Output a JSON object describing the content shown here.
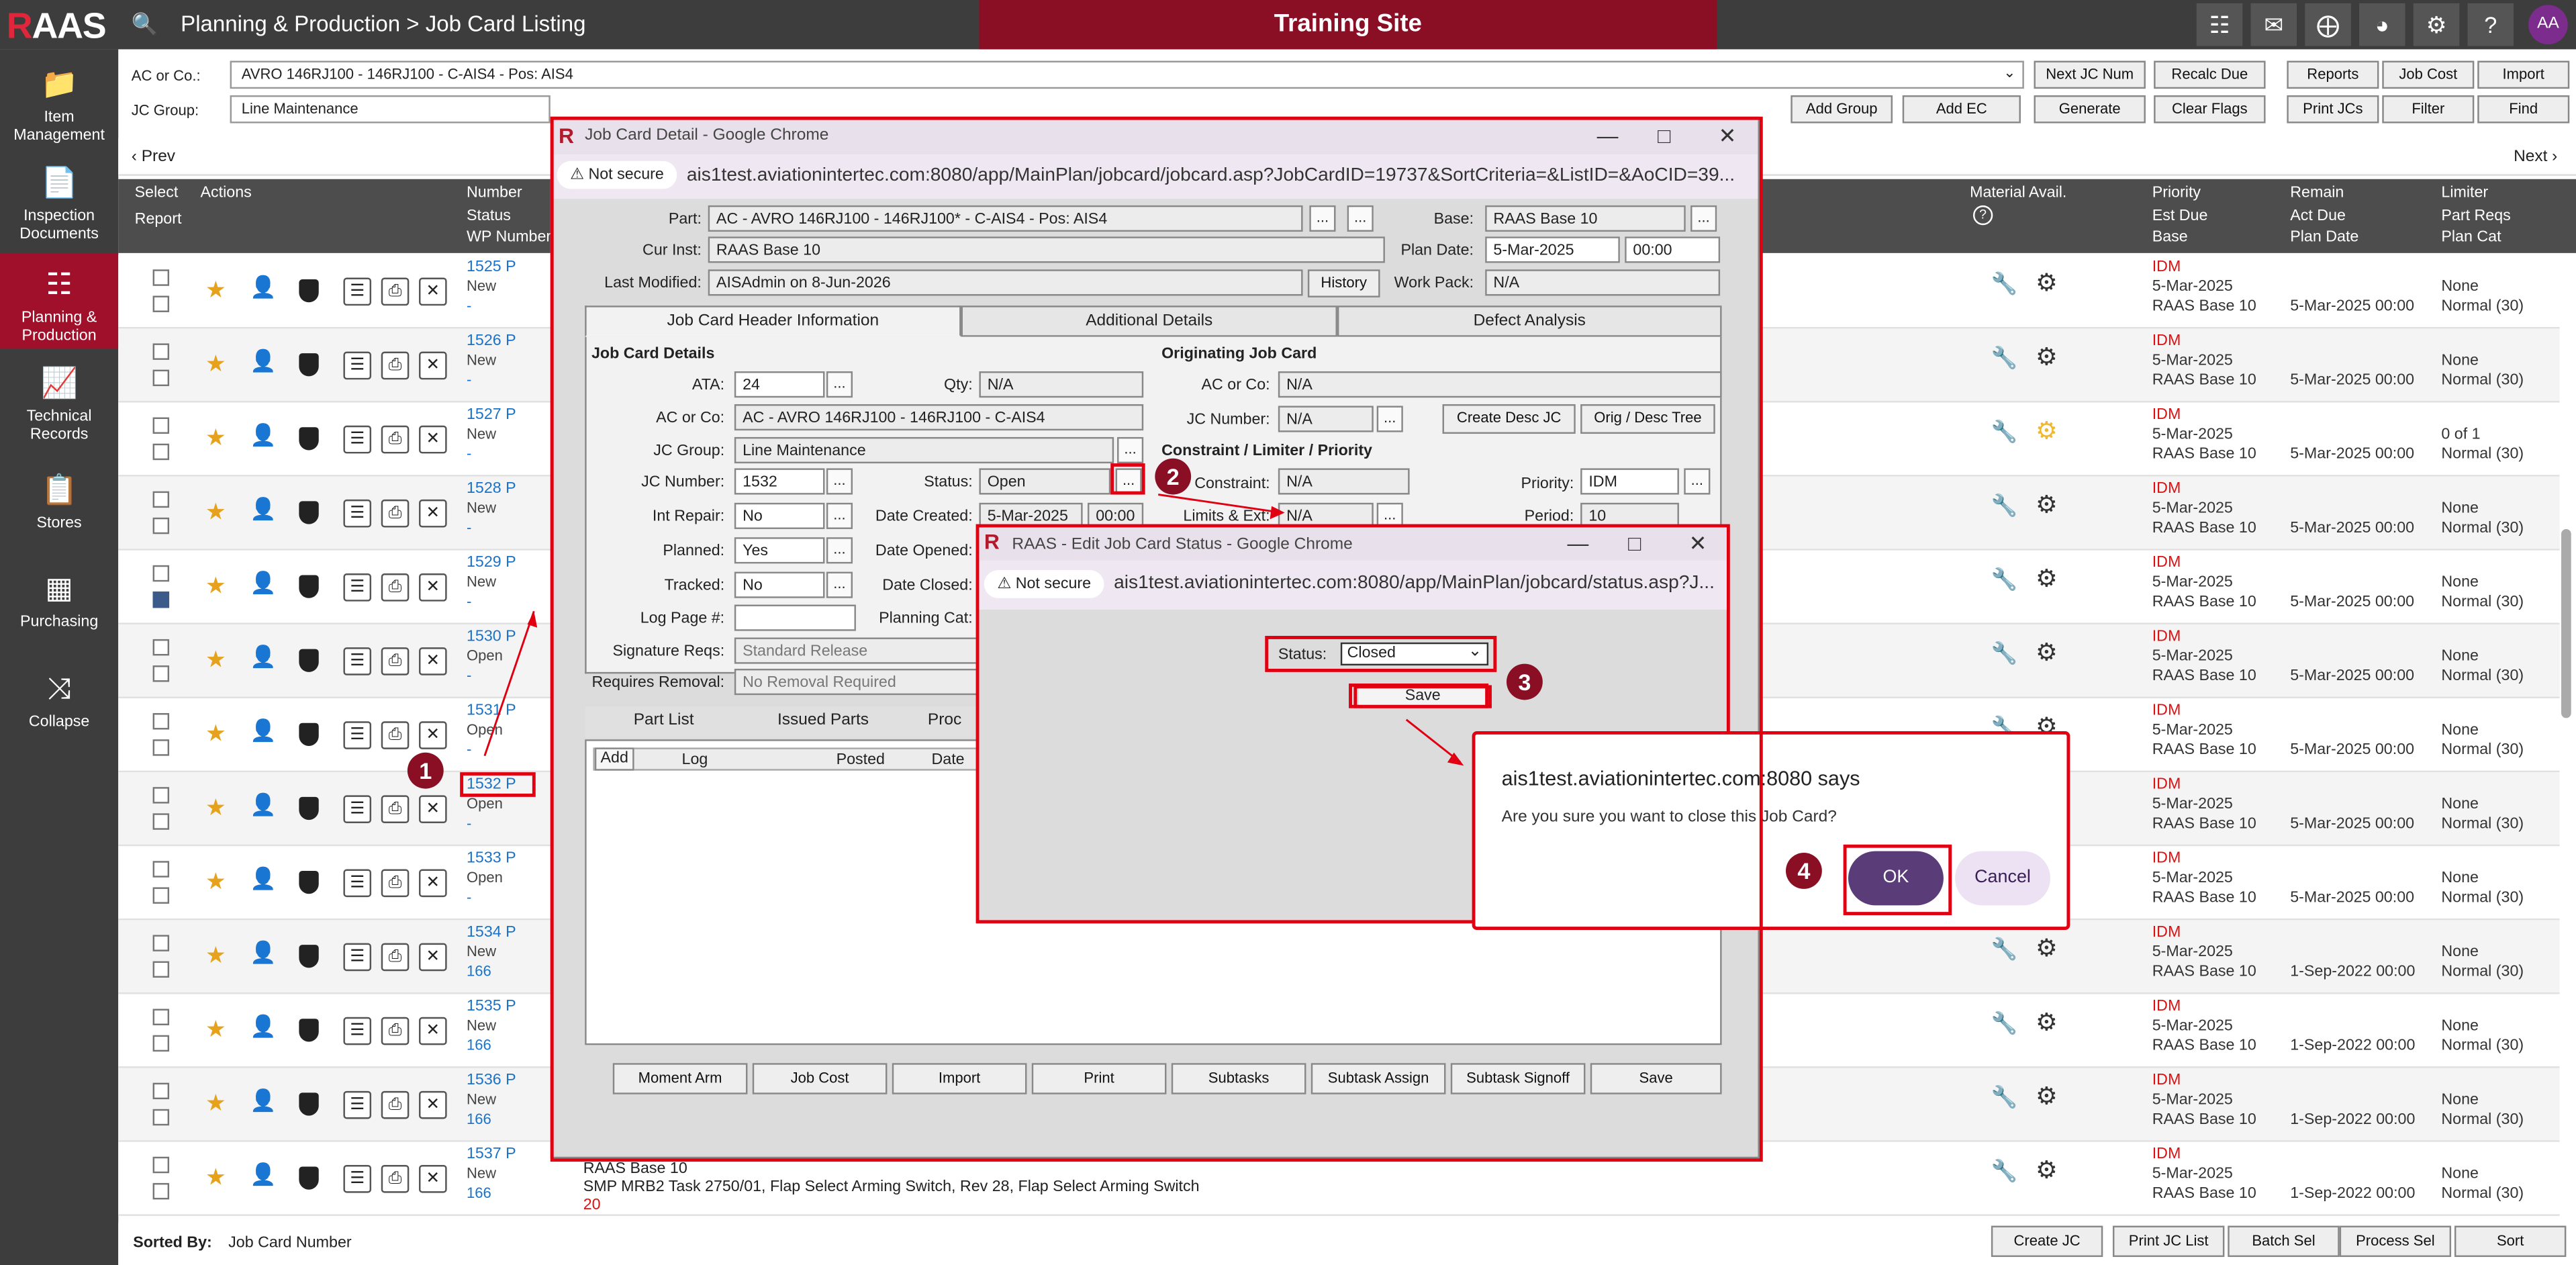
{
  "app": {
    "logo_r": "R",
    "logo_rest": "AAS",
    "breadcrumb": "Planning & Production > Job Card Listing",
    "banner": "Training Site",
    "avatar": "AA"
  },
  "sidebar": [
    {
      "label": "Item Management",
      "icon": "folder-icon"
    },
    {
      "label": "Inspection Documents",
      "icon": "document-icon"
    },
    {
      "label": "Planning & Production",
      "icon": "flow-icon"
    },
    {
      "label": "Technical Records",
      "icon": "records-icon"
    },
    {
      "label": "Stores",
      "icon": "clipboard-icon"
    },
    {
      "label": "Purchasing",
      "icon": "calculator-icon"
    },
    {
      "label": "Collapse",
      "icon": "collapse-icon"
    }
  ],
  "filters": {
    "ac_label": "AC or Co.:",
    "ac_value": "AVRO 146RJ100 - 146RJ100 - C-AIS4 - Pos: AIS4",
    "jc_label": "JC Group:",
    "jc_value": "Line Maintenance",
    "add_group": "Add Group",
    "add_ec": "Add EC"
  },
  "toolbar": {
    "next_jc": "Next JC Num",
    "recalc": "Recalc Due",
    "generate": "Generate",
    "clear_flags": "Clear Flags",
    "reports": "Reports",
    "job_cost": "Job Cost",
    "import": "Import",
    "print_jcs": "Print JCs",
    "filter": "Filter",
    "find": "Find"
  },
  "nav": {
    "prev": "Prev",
    "next": "Next"
  },
  "header": {
    "select": "Select",
    "report": "Report",
    "actions": "Actions",
    "number": "Number",
    "status": "Status",
    "wp": "WP Number",
    "material": "Material Avail.",
    "priority": "Priority",
    "est_due": "Est Due",
    "base": "Base",
    "remain": "Remain",
    "act_due": "Act Due",
    "plan_date": "Plan Date",
    "limiter": "Limiter",
    "part_reqs": "Part Reqs",
    "plan_cat": "Plan Cat"
  },
  "rows": [
    {
      "num": "1525 P",
      "status": "New",
      "wp": "-",
      "priority": "IDM",
      "date": "5-Mar-2025",
      "base": "RAAS Base 10",
      "plan": "5-Mar-2025 00:00",
      "limiter": "None",
      "cat": "Normal (30)",
      "checked": false
    },
    {
      "num": "1526 P",
      "status": "New",
      "wp": "-",
      "priority": "IDM",
      "date": "5-Mar-2025",
      "base": "RAAS Base 10",
      "plan": "5-Mar-2025 00:00",
      "limiter": "None",
      "cat": "Normal (30)",
      "checked": false
    },
    {
      "num": "1527 P",
      "status": "New",
      "wp": "-",
      "priority": "IDM",
      "date": "5-Mar-2025",
      "base": "RAAS Base 10",
      "plan": "5-Mar-2025 00:00",
      "limiter": "0 of 1",
      "cat": "Normal (30)",
      "checked": false
    },
    {
      "num": "1528 P",
      "status": "New",
      "wp": "-",
      "priority": "IDM",
      "date": "5-Mar-2025",
      "base": "RAAS Base 10",
      "plan": "5-Mar-2025 00:00",
      "limiter": "None",
      "cat": "Normal (30)",
      "checked": false
    },
    {
      "num": "1529 P",
      "status": "New",
      "wp": "-",
      "priority": "IDM",
      "date": "5-Mar-2025",
      "base": "RAAS Base 10",
      "plan": "5-Mar-2025 00:00",
      "limiter": "None",
      "cat": "Normal (30)",
      "checked": true
    },
    {
      "num": "1530 P",
      "status": "Open",
      "wp": "-",
      "priority": "IDM",
      "date": "5-Mar-2025",
      "base": "RAAS Base 10",
      "plan": "5-Mar-2025 00:00",
      "limiter": "None",
      "cat": "Normal (30)",
      "checked": false
    },
    {
      "num": "1531 P",
      "status": "Open",
      "wp": "-",
      "priority": "IDM",
      "date": "5-Mar-2025",
      "base": "RAAS Base 10",
      "plan": "5-Mar-2025 00:00",
      "limiter": "None",
      "cat": "Normal (30)",
      "checked": false
    },
    {
      "num": "1532 P",
      "status": "Open",
      "wp": "-",
      "priority": "IDM",
      "date": "5-Mar-2025",
      "base": "RAAS Base 10",
      "plan": "5-Mar-2025 00:00",
      "limiter": "None",
      "cat": "Normal (30)",
      "checked": false
    },
    {
      "num": "1533 P",
      "status": "Open",
      "wp": "-",
      "priority": "IDM",
      "date": "5-Mar-2025",
      "base": "RAAS Base 10",
      "plan": "5-Mar-2025 00:00",
      "limiter": "None",
      "cat": "Normal (30)",
      "checked": false
    },
    {
      "num": "1534 P",
      "status": "New",
      "wp": "166",
      "priority": "IDM",
      "date": "5-Mar-2025",
      "base": "RAAS Base 10",
      "plan": "1-Sep-2022 00:00",
      "limiter": "None",
      "cat": "Normal (30)",
      "checked": false
    },
    {
      "num": "1535 P",
      "status": "New",
      "wp": "166",
      "priority": "IDM",
      "date": "5-Mar-2025",
      "base": "RAAS Base 10",
      "plan": "1-Sep-2022 00:00",
      "limiter": "None",
      "cat": "Normal (30)",
      "checked": false
    },
    {
      "num": "1536 P",
      "status": "New",
      "wp": "166",
      "priority": "IDM",
      "date": "5-Mar-2025",
      "base": "RAAS Base 10",
      "plan": "1-Sep-2022 00:00",
      "limiter": "None",
      "cat": "Normal (30)",
      "checked": false
    },
    {
      "num": "1537 P",
      "status": "New",
      "wp": "166",
      "priority": "IDM",
      "date": "5-Mar-2025",
      "base": "RAAS Base 10",
      "plan": "1-Sep-2022 00:00",
      "limiter": "None",
      "cat": "Normal (30)",
      "checked": false
    }
  ],
  "last_row_desc": {
    "base": "RAAS Base 10",
    "task": "SMP MRB2 Task 2750/01, Flap Select Arming Switch, Rev 28, Flap Select Arming Switch",
    "num": "20"
  },
  "footer": {
    "sorted_label": "Sorted By:",
    "sorted_value": "Job Card Number",
    "create_jc": "Create JC",
    "print_list": "Print JC List",
    "batch": "Batch Sel",
    "process": "Process Sel",
    "sort": "Sort"
  },
  "jc_window": {
    "title": "Job Card Detail - Google Chrome",
    "not_secure": "Not secure",
    "url": "ais1test.aviationintertec.com:8080/app/MainPlan/jobcard/jobcard.asp?JobCardID=19737&SortCriteria=&ListID=&AoCID=39...",
    "part_label": "Part:",
    "part": "AC - AVRO 146RJ100 - 146RJ100* - C-AIS4 - Pos: AIS4",
    "base_label": "Base:",
    "base": "RAAS Base 10",
    "curinst_label": "Cur Inst:",
    "curinst": "RAAS Base 10",
    "plandate_label": "Plan Date:",
    "plandate": "5-Mar-2025",
    "plantime": "00:00",
    "lastmod_label": "Last Modified:",
    "lastmod": "AISAdmin on 8-Jun-2026",
    "history": "History",
    "workpack_label": "Work Pack:",
    "workpack": "N/A",
    "tabs": [
      "Job Card Header Information",
      "Additional Details",
      "Defect Analysis"
    ],
    "details_title": "Job Card Details",
    "ata_label": "ATA:",
    "ata": "24",
    "qty_label": "Qty:",
    "qty": "N/A",
    "acco_label": "AC or Co:",
    "acco": "AC - AVRO 146RJ100 - 146RJ100 - C-AIS4",
    "jcgroup_label": "JC Group:",
    "jcgroup": "Line Maintenance",
    "jcnum_label": "JC Number:",
    "jcnum": "1532",
    "status_label": "Status:",
    "status": "Open",
    "intrep_label": "Int Repair:",
    "intrep": "No",
    "created_label": "Date Created:",
    "created": "5-Mar-2025",
    "created_time": "00:00",
    "planned_label": "Planned:",
    "planned": "Yes",
    "opened_label": "Date Opened:",
    "tracked_label": "Tracked:",
    "tracked": "No",
    "closed_label": "Date Closed:",
    "logpage_label": "Log Page #:",
    "plancat_label": "Planning Cat:",
    "sigreqs_label": "Signature Reqs:",
    "sigreqs": "Standard Release",
    "reqrem_label": "Requires Removal:",
    "reqrem": "No Removal Required",
    "orig_title": "Originating Job Card",
    "oacco_label": "AC or Co:",
    "oacco": "N/A",
    "ojcnum_label": "JC Number:",
    "ojcnum": "N/A",
    "create_desc": "Create Desc JC",
    "orig_tree": "Orig / Desc Tree",
    "constraint_title": "Constraint / Limiter / Priority",
    "constraint_label": "Constraint:",
    "constraint": "N/A",
    "priority_label": "Priority:",
    "priority": "IDM",
    "limits_label": "Limits & Ext:",
    "limits": "N/A",
    "period_label": "Period:",
    "period": "10",
    "subtabs": [
      "Part List",
      "Issued Parts",
      "Proc"
    ],
    "log_add": "Add",
    "log_col": "Log",
    "posted_col": "Posted",
    "date_col": "Date",
    "buttons": [
      "Moment Arm",
      "Job Cost",
      "Import",
      "Print",
      "Subtasks",
      "Subtask Assign",
      "Subtask Signoff",
      "Save"
    ]
  },
  "status_window": {
    "title": "RAAS - Edit Job Card Status - Google Chrome",
    "not_secure": "Not secure",
    "url": "ais1test.aviationintertec.com:8080/app/MainPlan/jobcard/status.asp?J...",
    "status_label": "Status:",
    "status_value": "Closed",
    "save": "Save"
  },
  "dialog": {
    "title": "ais1test.aviationintertec.com:8080 says",
    "message": "Are you sure you want to close this Job Card?",
    "ok": "OK",
    "cancel": "Cancel"
  },
  "annotations": [
    "1",
    "2",
    "3",
    "4"
  ]
}
